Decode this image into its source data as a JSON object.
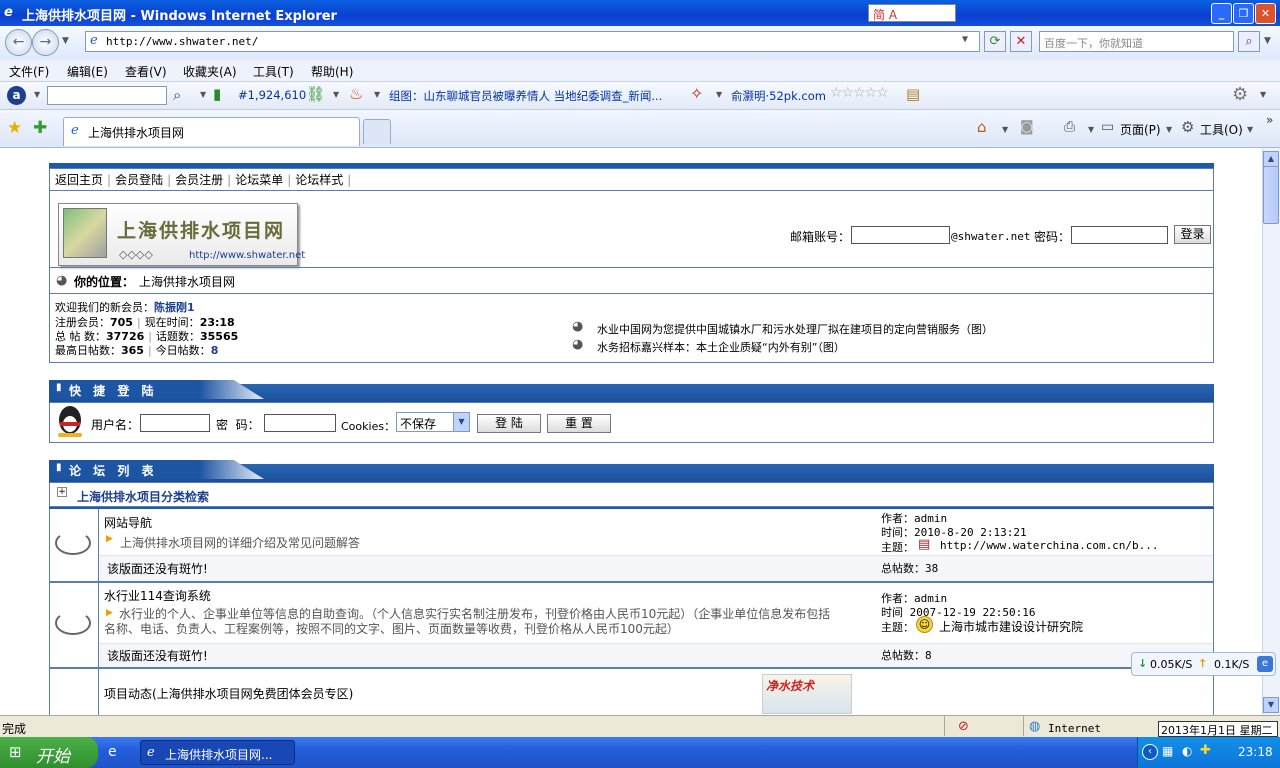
{
  "window": {
    "title": "上海供排水项目网 - Windows Internet Explorer",
    "ime": "简 A"
  },
  "address": {
    "url": "http://www.shwater.net/",
    "search_placeholder": "百度一下，你就知道"
  },
  "menu": [
    "文件(F)",
    "编辑(E)",
    "查看(V)",
    "收藏夹(A)",
    "工具(T)",
    "帮助(H)"
  ],
  "toolbar": {
    "rank": "#1,924,610",
    "news": "组图：山东聊城官员被曝养情人 当地纪委调查_新闻...",
    "game": "俞灏明·52pk.com"
  },
  "tab": {
    "title": "上海供排水项目网"
  },
  "commands": {
    "page": "页面(P)",
    "tools": "工具(O)"
  },
  "site": {
    "nav": [
      "返回主页",
      "会员登陆",
      "会员注册",
      "论坛菜单",
      "论坛样式"
    ],
    "logo_title": "上海供排水项目网",
    "logo_url": "http://www.shwater.net",
    "login": {
      "mail_label": "邮箱账号：",
      "domain": "@shwater.net",
      "pwd_label": "密码：",
      "button": "登录"
    },
    "location": {
      "label": "你的位置：",
      "value": "上海供排水项目网"
    },
    "stats": {
      "welcome": "欢迎我们的新会员：",
      "new_member": "陈振刚1",
      "members_label": "注册会员：",
      "members": "705",
      "time_label": "现在时间：",
      "time": "23:18",
      "posts_label": "总 帖 数：",
      "posts": "37726",
      "topics_label": "话题数：",
      "topics": "35565",
      "max_label": "最高日帖数：",
      "max": "365",
      "today_label": "今日帖数：",
      "today": "8"
    },
    "ads": [
      "水业中国网为您提供中国城镇水厂和污水处理厂拟在建项目的定向营销服务（图）",
      "水务招标嘉兴样本：本土企业质疑“内外有别”（图）"
    ],
    "quick_login": {
      "title": "快 捷 登 陆",
      "user": "用户名：",
      "pwd": "密  码：",
      "cookies": "Cookies：",
      "cookie_value": "不保存",
      "submit": "登 陆",
      "reset": "重 置"
    },
    "forum_list": {
      "title": "论 坛 列 表",
      "category": "上海供排水项目分类检索",
      "forums": [
        {
          "name": "网站导航",
          "desc": "上海供排水项目网的详细介绍及常见问题解答",
          "moderator": "该版面还没有斑竹!",
          "author": "作者：admin",
          "time": "时间：2010-8-20 2:13:21",
          "topic_label": "主题：",
          "topic": "http://www.waterchina.com.cn/b...",
          "count": "总帖数：38"
        },
        {
          "name": "水行业114查询系统",
          "desc": "水行业的个人、企事业单位等信息的自助查询。（个人信息实行实名制注册发布，刊登价格由人民币10元起）（企事业单位信息发布包括名称、电话、负责人、工程案例等，按照不同的文字、图片、页面数量等收费，刊登价格从人民币100元起）",
          "moderator": "该版面还没有斑竹!",
          "author": "作者：admin",
          "time": "时间  2007-12-19 22:50:16",
          "topic_label": "主题：",
          "topic": "上海市城市建设设计研究院",
          "count": "总帖数：8"
        },
        {
          "name": "项目动态(上海供排水项目网免费团体会员专区)",
          "banner": "净水技术"
        }
      ]
    }
  },
  "net": {
    "down": "0.05K/S",
    "up": "0.1K/S"
  },
  "status": {
    "text": "完成",
    "zone": "Internet",
    "date": "2013年1月1日 星期二"
  },
  "taskbar": {
    "start": "开始",
    "task": "上海供排水项目网...",
    "clock": "23:18"
  }
}
